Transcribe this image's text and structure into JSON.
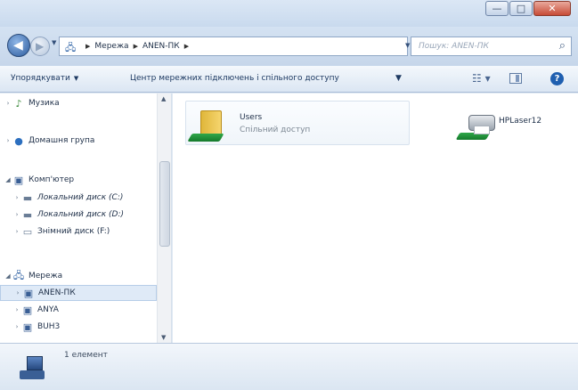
{
  "window": {
    "buttons": {
      "minimize": "—",
      "maximize": "□",
      "close": "✕"
    }
  },
  "address": {
    "crumbs": [
      "Мережа",
      "ANEN-ПК"
    ],
    "search_placeholder": "Пошук: ANEN-ПК"
  },
  "toolbar": {
    "organize_label": "Упорядкувати",
    "network_center_label": "Центр мережних підключень і спільного доступу"
  },
  "nav": {
    "items": [
      {
        "label": "Музика",
        "icon": "music-icon",
        "expander": "›"
      },
      {
        "label": "Домашня група",
        "icon": "homegroup-icon",
        "expander": "›"
      },
      {
        "label": "Комп'ютер",
        "icon": "computer-icon",
        "expander": "◢"
      },
      {
        "label": "Локальний диск (C:)",
        "icon": "drive-icon",
        "expander": "›"
      },
      {
        "label": "Локальний диск (D:)",
        "icon": "drive-icon",
        "expander": "›"
      },
      {
        "label": "Знімний диск (F:)",
        "icon": "removable-drive-icon",
        "expander": "›"
      },
      {
        "label": "Мережа",
        "icon": "network-icon",
        "expander": "◢"
      },
      {
        "label": "ANEN-ПК",
        "icon": "network-computer-icon",
        "expander": "›",
        "selected": true
      },
      {
        "label": "ANYA",
        "icon": "network-computer-icon",
        "expander": "›"
      },
      {
        "label": "BUH3",
        "icon": "network-computer-icon",
        "expander": "›"
      }
    ]
  },
  "content": {
    "items": [
      {
        "title": "Users",
        "subtitle": "Спільний доступ",
        "icon": "shared-folder-icon"
      },
      {
        "title": "HPLaser12",
        "icon": "shared-printer-icon"
      }
    ]
  },
  "details": {
    "count_text": "1 елемент"
  },
  "colors": {
    "accent": "#1f5fb0",
    "selection_bg": "#dfeaf7",
    "share_green": "#2fa84a",
    "folder_yellow": "#e0b63a"
  }
}
